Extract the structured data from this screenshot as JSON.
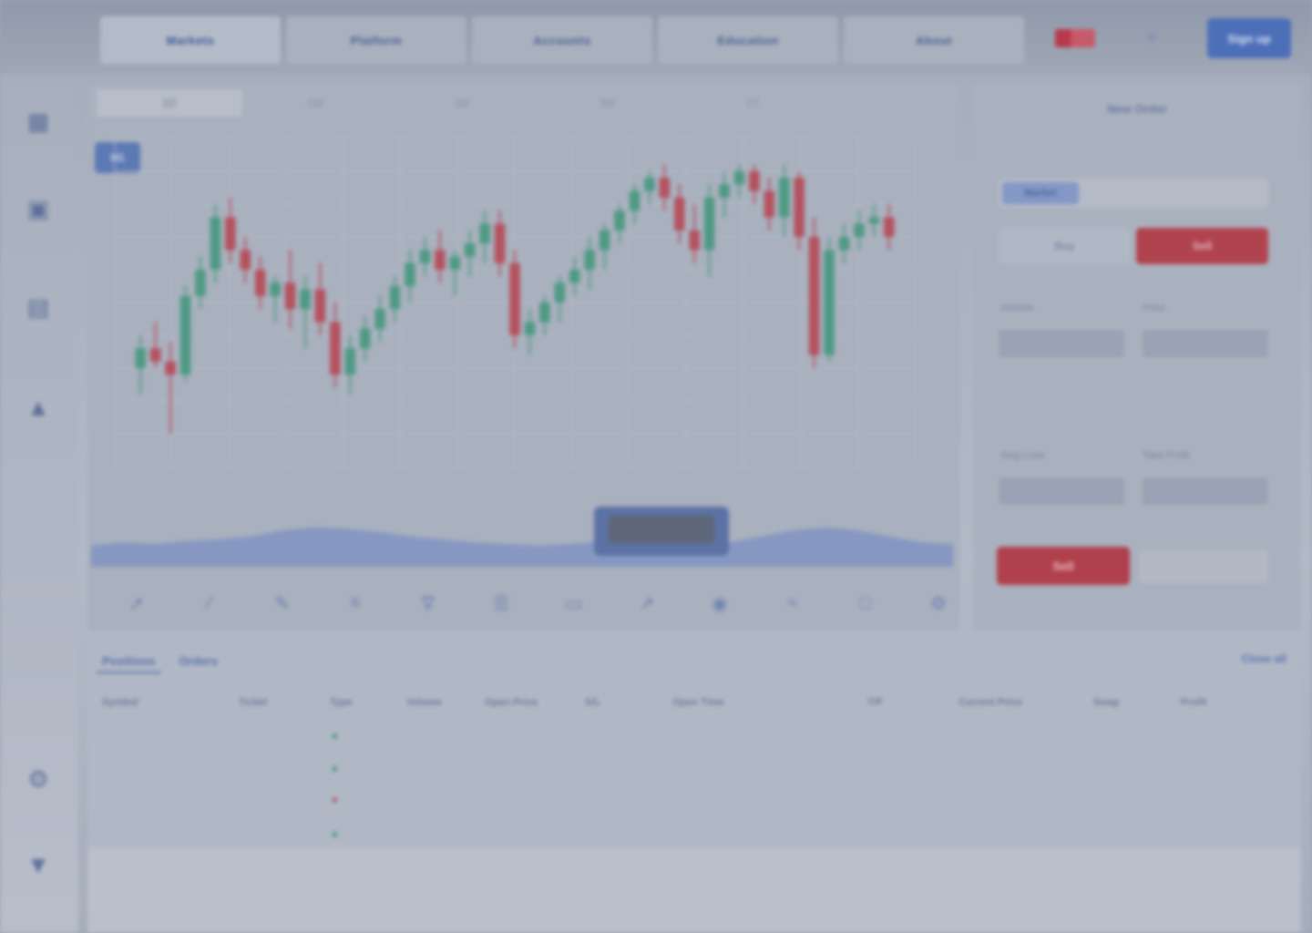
{
  "topbar": {
    "nav_tabs": [
      "Markets",
      "Platform",
      "Accounts",
      "Education",
      "About"
    ],
    "cta_label": "Sign up",
    "colors": {
      "brand": "#4d6fb8",
      "sell": "#b1434f",
      "buy": "#3c8e6a"
    }
  },
  "leftrail": {
    "items": [
      {
        "icon": "chart-icon",
        "label": ""
      },
      {
        "icon": "portfolio-icon",
        "label": ""
      },
      {
        "icon": "news-icon",
        "label": ""
      },
      {
        "icon": "alert-icon",
        "label": ""
      },
      {
        "icon": "settings-icon",
        "label": ""
      },
      {
        "icon": "help-icon",
        "label": ""
      }
    ]
  },
  "chart_panel": {
    "timeframes": [
      "1D",
      "1W",
      "1M",
      "3M",
      "1Y"
    ],
    "active_timeframe_index": 0,
    "interval_badge": "H1",
    "navigator_range_label": "",
    "navigator_caption": "",
    "tools": [
      "trendline-icon",
      "ray-icon",
      "pencil-icon",
      "fib-icon",
      "text-icon",
      "measure-icon",
      "rectangle-icon",
      "arrow-icon",
      "camera-icon",
      "indicator-icon",
      "fullscreen-icon",
      "settings-icon"
    ]
  },
  "order_panel": {
    "title": "New Order",
    "order_type": "Market",
    "buy_label": "Buy",
    "sell_label": "Sell",
    "fields": [
      {
        "label": "Volume",
        "value": ""
      },
      {
        "label": "Price",
        "value": ""
      },
      {
        "label": "Stop Loss",
        "value": ""
      },
      {
        "label": "Take Profit",
        "value": ""
      }
    ],
    "notes": [
      "",
      ""
    ],
    "submit_label": "Sell",
    "cancel_label": ""
  },
  "positions": {
    "tabs": [
      "Positions",
      "Orders"
    ],
    "action_label": "Close all",
    "columns": [
      "Symbol",
      "Ticket",
      "Type",
      "Volume",
      "Open Price",
      "S/L",
      "Open Time",
      "T/P",
      "Current Price",
      "Swap",
      "Profit"
    ],
    "rows": [
      {
        "symbol": "",
        "ticket": "",
        "type": "▲",
        "dir": "up",
        "volume": "",
        "open": "",
        "sl": "",
        "time": "",
        "tp": "",
        "current": "",
        "swap": "",
        "profit": ""
      },
      {
        "symbol": "",
        "ticket": "",
        "type": "▲",
        "dir": "up",
        "volume": "",
        "open": "",
        "sl": "",
        "time": "",
        "tp": "",
        "current": "",
        "swap": "",
        "profit": ""
      },
      {
        "symbol": "",
        "ticket": "",
        "type": "▼",
        "dir": "down",
        "volume": "",
        "open": "",
        "sl": "",
        "time": "",
        "tp": "",
        "current": "",
        "swap": "",
        "profit": ""
      },
      {
        "symbol": "",
        "ticket": "",
        "type": "▲",
        "dir": "up",
        "volume": "",
        "open": "",
        "sl": "",
        "time": "",
        "tp": "",
        "current": "",
        "swap": "",
        "profit": ""
      }
    ]
  },
  "chart_data": {
    "type": "candlestick",
    "ylim": [
      0,
      100
    ],
    "grid": true,
    "candles": [
      {
        "o": 30,
        "h": 40,
        "l": 22,
        "c": 36
      },
      {
        "o": 36,
        "h": 44,
        "l": 30,
        "c": 32
      },
      {
        "o": 32,
        "h": 38,
        "l": 10,
        "c": 28
      },
      {
        "o": 28,
        "h": 55,
        "l": 26,
        "c": 52
      },
      {
        "o": 52,
        "h": 64,
        "l": 48,
        "c": 60
      },
      {
        "o": 60,
        "h": 80,
        "l": 56,
        "c": 76
      },
      {
        "o": 76,
        "h": 82,
        "l": 62,
        "c": 66
      },
      {
        "o": 66,
        "h": 70,
        "l": 56,
        "c": 60
      },
      {
        "o": 60,
        "h": 64,
        "l": 48,
        "c": 52
      },
      {
        "o": 52,
        "h": 58,
        "l": 44,
        "c": 56
      },
      {
        "o": 56,
        "h": 66,
        "l": 42,
        "c": 48
      },
      {
        "o": 48,
        "h": 58,
        "l": 36,
        "c": 54
      },
      {
        "o": 54,
        "h": 62,
        "l": 40,
        "c": 44
      },
      {
        "o": 44,
        "h": 50,
        "l": 24,
        "c": 28
      },
      {
        "o": 28,
        "h": 40,
        "l": 22,
        "c": 36
      },
      {
        "o": 36,
        "h": 46,
        "l": 32,
        "c": 42
      },
      {
        "o": 42,
        "h": 52,
        "l": 38,
        "c": 48
      },
      {
        "o": 48,
        "h": 58,
        "l": 44,
        "c": 55
      },
      {
        "o": 55,
        "h": 66,
        "l": 50,
        "c": 62
      },
      {
        "o": 62,
        "h": 70,
        "l": 58,
        "c": 66
      },
      {
        "o": 66,
        "h": 72,
        "l": 56,
        "c": 60
      },
      {
        "o": 60,
        "h": 66,
        "l": 52,
        "c": 64
      },
      {
        "o": 64,
        "h": 72,
        "l": 58,
        "c": 68
      },
      {
        "o": 68,
        "h": 78,
        "l": 62,
        "c": 74
      },
      {
        "o": 74,
        "h": 78,
        "l": 58,
        "c": 62
      },
      {
        "o": 62,
        "h": 66,
        "l": 36,
        "c": 40
      },
      {
        "o": 40,
        "h": 48,
        "l": 34,
        "c": 44
      },
      {
        "o": 44,
        "h": 52,
        "l": 40,
        "c": 50
      },
      {
        "o": 50,
        "h": 58,
        "l": 44,
        "c": 56
      },
      {
        "o": 56,
        "h": 64,
        "l": 52,
        "c": 60
      },
      {
        "o": 60,
        "h": 70,
        "l": 54,
        "c": 66
      },
      {
        "o": 66,
        "h": 74,
        "l": 60,
        "c": 72
      },
      {
        "o": 72,
        "h": 80,
        "l": 68,
        "c": 78
      },
      {
        "o": 78,
        "h": 86,
        "l": 74,
        "c": 84
      },
      {
        "o": 84,
        "h": 90,
        "l": 80,
        "c": 88
      },
      {
        "o": 88,
        "h": 92,
        "l": 78,
        "c": 82
      },
      {
        "o": 82,
        "h": 86,
        "l": 68,
        "c": 72
      },
      {
        "o": 72,
        "h": 80,
        "l": 62,
        "c": 66
      },
      {
        "o": 66,
        "h": 86,
        "l": 58,
        "c": 82
      },
      {
        "o": 82,
        "h": 90,
        "l": 76,
        "c": 86
      },
      {
        "o": 86,
        "h": 92,
        "l": 82,
        "c": 90
      },
      {
        "o": 90,
        "h": 92,
        "l": 80,
        "c": 84
      },
      {
        "o": 84,
        "h": 88,
        "l": 72,
        "c": 76
      },
      {
        "o": 76,
        "h": 92,
        "l": 70,
        "c": 88
      },
      {
        "o": 88,
        "h": 90,
        "l": 66,
        "c": 70
      },
      {
        "o": 70,
        "h": 76,
        "l": 30,
        "c": 34
      },
      {
        "o": 34,
        "h": 70,
        "l": 32,
        "c": 66
      },
      {
        "o": 66,
        "h": 74,
        "l": 62,
        "c": 70
      },
      {
        "o": 70,
        "h": 78,
        "l": 66,
        "c": 74
      },
      {
        "o": 74,
        "h": 80,
        "l": 70,
        "c": 76
      },
      {
        "o": 76,
        "h": 80,
        "l": 66,
        "c": 70
      }
    ],
    "navigator": [
      8,
      10,
      9,
      11,
      12,
      14,
      18,
      20,
      19,
      17,
      14,
      12,
      10,
      9,
      8,
      9,
      11,
      10,
      9,
      8,
      10,
      14,
      18,
      20,
      18,
      14,
      10,
      9
    ]
  }
}
